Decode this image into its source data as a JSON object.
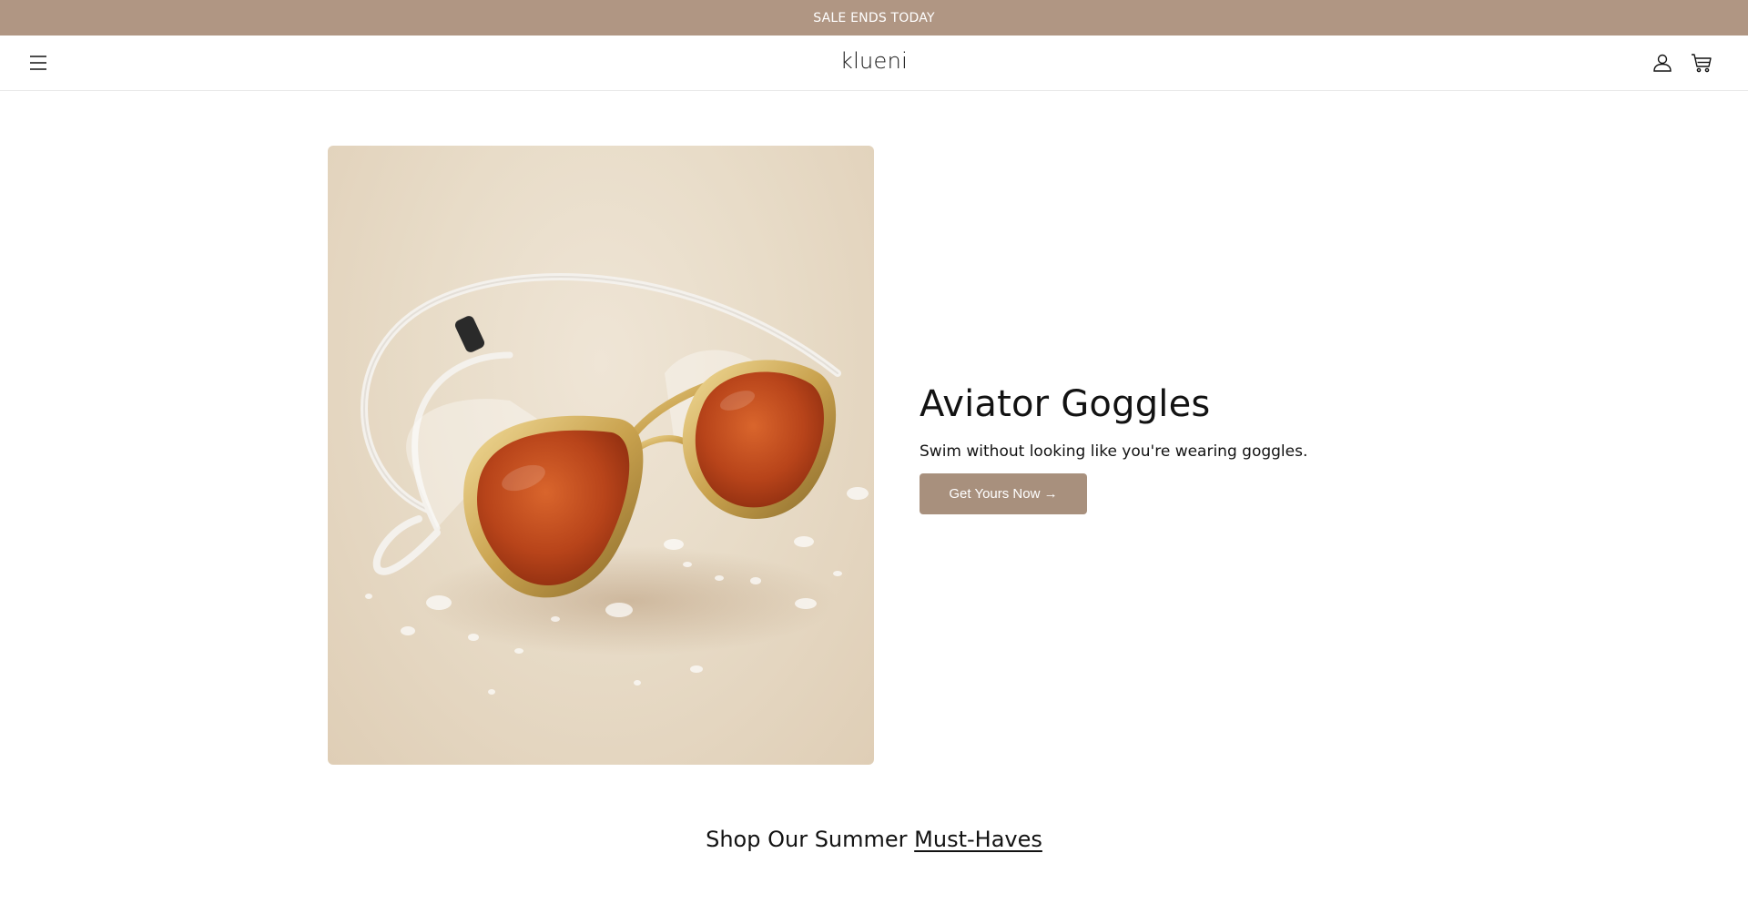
{
  "announcement": {
    "text": "SALE ENDS TODAY"
  },
  "header": {
    "logo": "klueni",
    "menu_icon": "hamburger-menu-icon",
    "account_icon": "account-icon",
    "cart_icon": "cart-icon"
  },
  "hero": {
    "image_alt": "Aviator style swim goggles with orange lenses",
    "title": "Aviator Goggles",
    "subtitle": "Swim without looking like you're wearing goggles.",
    "cta_label": "Get Yours Now →"
  },
  "collection": {
    "heading_prefix": "Shop Our Summer ",
    "heading_emphasis": "Must-Haves"
  },
  "colors": {
    "announcement_bg": "#b09683",
    "cta_bg": "#a8907d",
    "text": "#121212"
  }
}
